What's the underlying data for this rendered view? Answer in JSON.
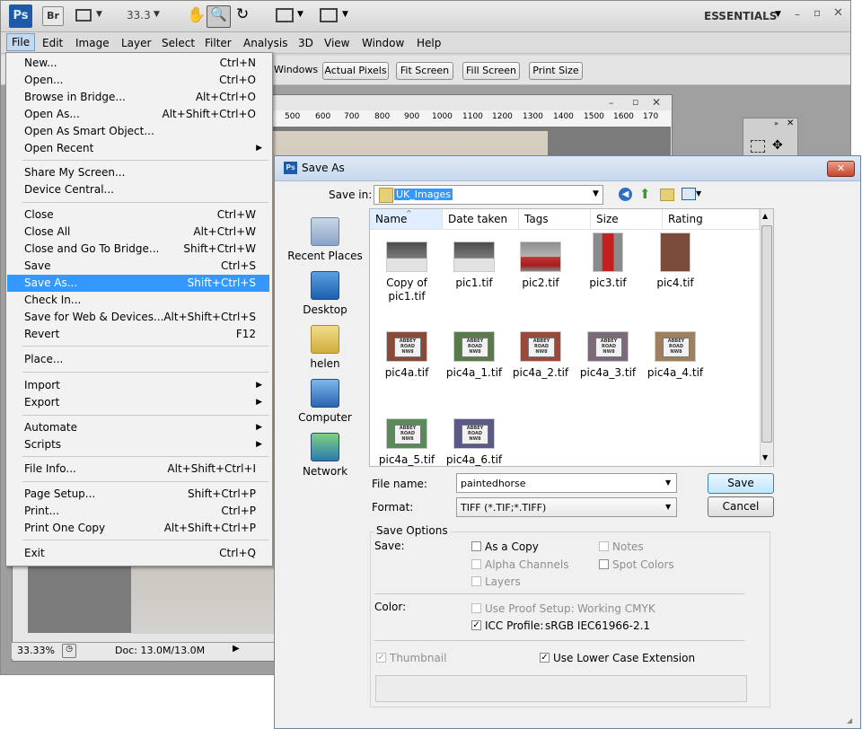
{
  "appbar": {
    "ps_logo": "Ps",
    "br_logo": "Br",
    "zoom": "33.3",
    "workspace": "ESSENTIALS"
  },
  "menubar": [
    "File",
    "Edit",
    "Image",
    "Layer",
    "Select",
    "Filter",
    "Analysis",
    "3D",
    "View",
    "Window",
    "Help"
  ],
  "options": [
    "Windows",
    "Actual Pixels",
    "Fit Screen",
    "Fill Screen",
    "Print Size"
  ],
  "ruler": [
    "500",
    "600",
    "700",
    "800",
    "900",
    "1000",
    "1100",
    "1200",
    "1300",
    "1400",
    "1500",
    "1600",
    "170"
  ],
  "status": {
    "zoom": "33.33%",
    "doc": "Doc: 13.0M/13.0M"
  },
  "file_menu": {
    "items": [
      {
        "label": "New...",
        "shortcut": "Ctrl+N"
      },
      {
        "label": "Open...",
        "shortcut": "Ctrl+O"
      },
      {
        "label": "Browse in Bridge...",
        "shortcut": "Alt+Ctrl+O"
      },
      {
        "label": "Open As...",
        "shortcut": "Alt+Shift+Ctrl+O"
      },
      {
        "label": "Open As Smart Object...",
        "shortcut": ""
      },
      {
        "label": "Open Recent",
        "shortcut": ""
      },
      {
        "label": "Share My Screen...",
        "shortcut": ""
      },
      {
        "label": "Device Central...",
        "shortcut": ""
      },
      {
        "label": "Close",
        "shortcut": "Ctrl+W"
      },
      {
        "label": "Close All",
        "shortcut": "Alt+Ctrl+W"
      },
      {
        "label": "Close and Go To Bridge...",
        "shortcut": "Shift+Ctrl+W"
      },
      {
        "label": "Save",
        "shortcut": "Ctrl+S"
      },
      {
        "label": "Save As...",
        "shortcut": "Shift+Ctrl+S"
      },
      {
        "label": "Check In...",
        "shortcut": ""
      },
      {
        "label": "Save for Web & Devices...",
        "shortcut": "Alt+Shift+Ctrl+S"
      },
      {
        "label": "Revert",
        "shortcut": "F12"
      },
      {
        "label": "Place...",
        "shortcut": ""
      },
      {
        "label": "Import",
        "shortcut": ""
      },
      {
        "label": "Export",
        "shortcut": ""
      },
      {
        "label": "Automate",
        "shortcut": ""
      },
      {
        "label": "Scripts",
        "shortcut": ""
      },
      {
        "label": "File Info...",
        "shortcut": "Alt+Shift+Ctrl+I"
      },
      {
        "label": "Page Setup...",
        "shortcut": "Shift+Ctrl+P"
      },
      {
        "label": "Print...",
        "shortcut": "Ctrl+P"
      },
      {
        "label": "Print One Copy",
        "shortcut": "Alt+Shift+Ctrl+P"
      },
      {
        "label": "Exit",
        "shortcut": "Ctrl+Q"
      }
    ],
    "submenu_arrow": "▶"
  },
  "dialog": {
    "title": "Save As",
    "save_in_label": "Save in:",
    "save_in_value": "UK_Images",
    "places": [
      "Recent Places",
      "Desktop",
      "helen",
      "Computer",
      "Network"
    ],
    "columns": [
      "Name",
      "Date taken",
      "Tags",
      "Size",
      "Rating"
    ],
    "files": [
      {
        "name": "Copy of pic1.tif",
        "kind": "street"
      },
      {
        "name": "pic1.tif",
        "kind": "street"
      },
      {
        "name": "pic2.tif",
        "kind": "bus"
      },
      {
        "name": "pic3.tif",
        "kind": "postbox"
      },
      {
        "name": "pic4.tif",
        "kind": "brick"
      },
      {
        "name": "pic4a.tif",
        "kind": "sign"
      },
      {
        "name": "pic4a_1.tif",
        "kind": "sign"
      },
      {
        "name": "pic4a_2.tif",
        "kind": "sign"
      },
      {
        "name": "pic4a_3.tif",
        "kind": "sign"
      },
      {
        "name": "pic4a_4.tif",
        "kind": "sign"
      },
      {
        "name": "pic4a_5.tif",
        "kind": "sign"
      },
      {
        "name": "pic4a_6.tif",
        "kind": "sign"
      }
    ],
    "sign_text": "ABBEY ROAD NW8",
    "file_name_label": "File name:",
    "file_name_value": "paintedhorse",
    "format_label": "Format:",
    "format_value": "TIFF (*.TIF;*.TIFF)",
    "save_button": "Save",
    "cancel_button": "Cancel",
    "save_options_label": "Save Options",
    "save_label": "Save:",
    "opt_as_copy": "As a Copy",
    "opt_notes": "Notes",
    "opt_alpha": "Alpha Channels",
    "opt_spot": "Spot Colors",
    "opt_layers": "Layers",
    "color_label": "Color:",
    "opt_proof": "Use Proof Setup:",
    "proof_value": "Working CMYK",
    "opt_icc": "ICC Profile:",
    "icc_value": "sRGB IEC61966-2.1",
    "opt_thumbnail": "Thumbnail",
    "opt_lowercase": "Use Lower Case Extension"
  },
  "colors": {
    "accent": "#3399ff",
    "ps_blue": "#1f4f8f"
  }
}
